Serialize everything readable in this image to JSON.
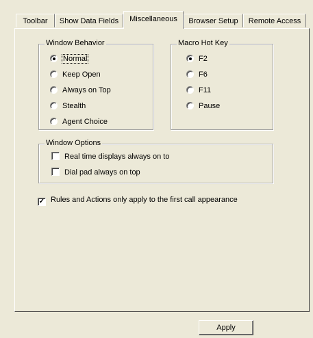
{
  "tabs": [
    "Toolbar",
    "Show Data Fields",
    "Miscellaneous",
    "Browser Setup",
    "Remote Access"
  ],
  "active_tab": "Miscellaneous",
  "window_behavior": {
    "label": "Window Behavior",
    "options": [
      "Normal",
      "Keep Open",
      "Always on Top",
      "Stealth",
      "Agent Choice"
    ],
    "selected": "Normal"
  },
  "macro_hot_key": {
    "label": "Macro Hot Key",
    "options": [
      "F2",
      "F6",
      "F11",
      "Pause"
    ],
    "selected": "F2"
  },
  "window_options": {
    "label": "Window Options",
    "checks": [
      {
        "label": "Real time displays always on to",
        "checked": false
      },
      {
        "label": "Dial pad always on top",
        "checked": false
      }
    ]
  },
  "rules_check": {
    "label": "Rules and Actions only apply to the first call appearance",
    "checked": true
  },
  "apply_label": "Apply"
}
